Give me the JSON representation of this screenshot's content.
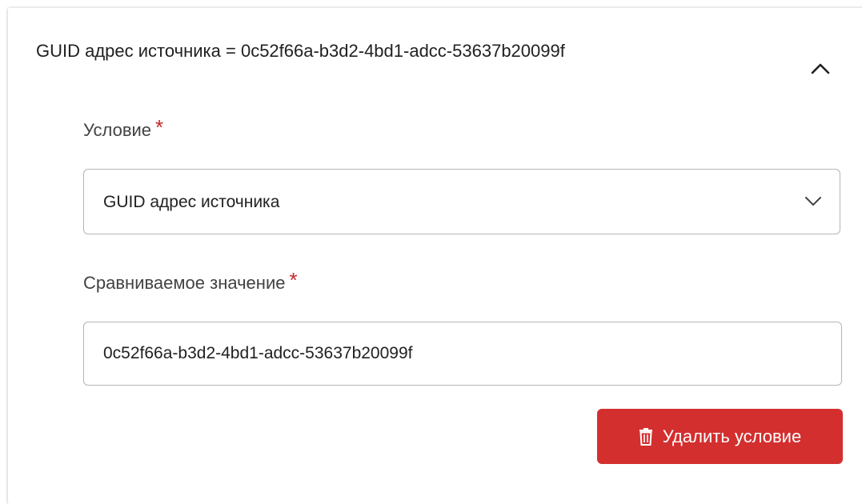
{
  "condition_panel": {
    "header_title": "GUID адрес источника = 0c52f66a-b3d2-4bd1-adcc-53637b20099f",
    "collapse_icon": "chevron-up-icon",
    "condition_field": {
      "label": "Условие",
      "required_mark": "*",
      "selected_value": "GUID адрес источника",
      "dropdown_icon": "chevron-down-icon"
    },
    "compare_value_field": {
      "label": "Сравниваемое значение",
      "required_mark": "*",
      "value": "0c52f66a-b3d2-4bd1-adcc-53637b20099f"
    },
    "delete_button": {
      "label": "Удалить условие",
      "icon": "trash-icon"
    }
  },
  "colors": {
    "danger": "#d32f2f",
    "required": "#c62828",
    "border": "#b5b5b5",
    "text": "#212121"
  }
}
